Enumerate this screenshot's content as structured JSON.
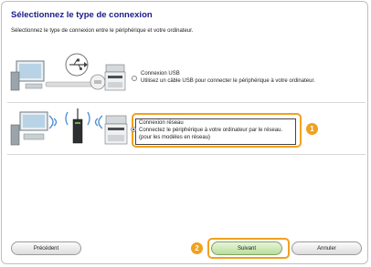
{
  "header": {
    "title": "Sélectionnez le type de connexion",
    "subtitle": "Sélectionnez le type de connexion entre le périphérique et votre ordinateur."
  },
  "options": [
    {
      "label": "Connexion USB",
      "description": "Utilisez un câble USB pour connecter le périphérique à votre ordinateur.",
      "selected": false,
      "icons": [
        "computer-icon",
        "usb-icon",
        "printer-icon"
      ]
    },
    {
      "label": "Connexion réseau",
      "description": "Connectez le périphérique à votre ordinateur par le réseau.",
      "note": "(pour les modèles en réseau)",
      "selected": true,
      "icons": [
        "laptop-icon",
        "wifi-icon",
        "router-icon",
        "printer-icon"
      ]
    }
  ],
  "callouts": {
    "step1": "1",
    "step2": "2"
  },
  "footer": {
    "back_label": "Précédent",
    "next_label": "Suivant",
    "cancel_label": "Annuler"
  },
  "colors": {
    "accent": "#f0a11f",
    "title": "#1a1a8c",
    "next_button": "#b9dd9c"
  }
}
